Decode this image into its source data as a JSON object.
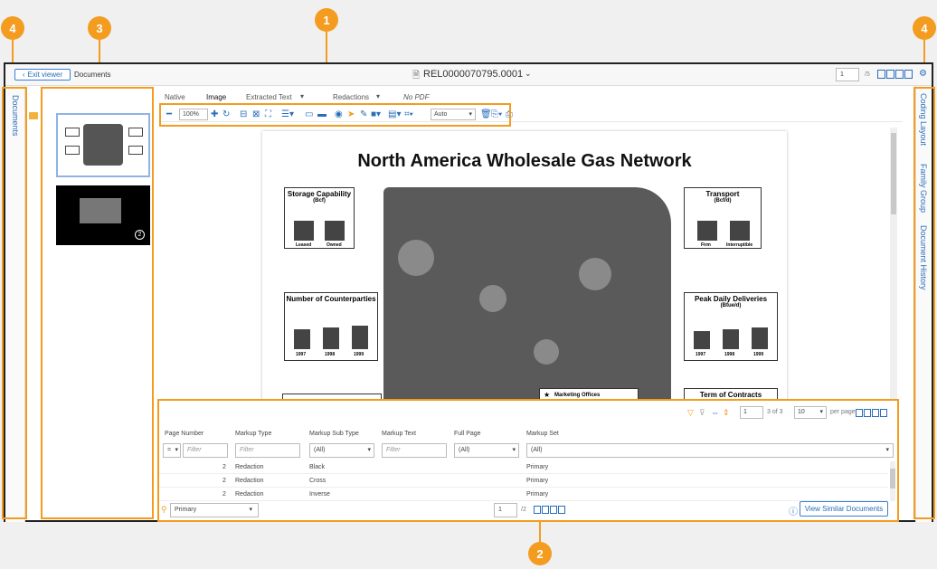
{
  "callouts": [
    "1",
    "2",
    "3",
    "4",
    "4"
  ],
  "header": {
    "exit_label": "Exit viewer",
    "documents_label": "Documents",
    "doc_title": "REL0000070795.0001",
    "page_input": "1",
    "page_total": "/5"
  },
  "left_panel": {
    "label": "Documents"
  },
  "right_panel": {
    "tabs": [
      "Coding Layout",
      "Family Group",
      "Document History"
    ]
  },
  "viewer_tabs": {
    "native": "Native",
    "image": "Image",
    "extracted": "Extracted Text",
    "redactions": "Redactions",
    "nopdf": "No PDF"
  },
  "toolbar": {
    "zoom": "100%",
    "auto": "Auto"
  },
  "thumbnail_badge": "2",
  "document": {
    "title": "North America Wholesale Gas Network",
    "storage": {
      "title": "Storage Capability",
      "unit": "(Bcf)",
      "labels": [
        "Leased",
        "Owned"
      ]
    },
    "transport": {
      "title": "Transport",
      "unit": "(Bcf/d)",
      "labels": [
        "Firm",
        "Interruptible"
      ]
    },
    "counterparties": {
      "title": "Number of Counterparties",
      "labels": [
        "1997",
        "1998",
        "1999"
      ]
    },
    "deliveries": {
      "title": "Peak Daily Deliveries",
      "unit": "(Btue/d)",
      "labels": [
        "1997",
        "1998",
        "1999"
      ]
    },
    "marketing": "Marketing Offices",
    "contracts": "Term of Contracts"
  },
  "markup": {
    "paging": "3 of 3",
    "per_page_value": "10",
    "per_page_label": "per page",
    "page_input": "1",
    "columns": [
      "Page Number",
      "Markup Type",
      "Markup Sub Type",
      "Markup Text",
      "Full Page",
      "Markup Set"
    ],
    "filters": {
      "op": "=",
      "placeholder": "Filter",
      "all": "(All)"
    },
    "rows": [
      {
        "page": "2",
        "type": "Redaction",
        "sub": "Black",
        "set": "Primary"
      },
      {
        "page": "2",
        "type": "Redaction",
        "sub": "Cross",
        "set": "Primary"
      },
      {
        "page": "2",
        "type": "Redaction",
        "sub": "Inverse",
        "set": "Primary"
      }
    ],
    "footer_set": "Primary",
    "footer_page": "1",
    "footer_total": "/2",
    "similar_button": "View Similar Documents"
  },
  "colors": {
    "accent": "#f39c1f",
    "link": "#2a6ebb"
  }
}
